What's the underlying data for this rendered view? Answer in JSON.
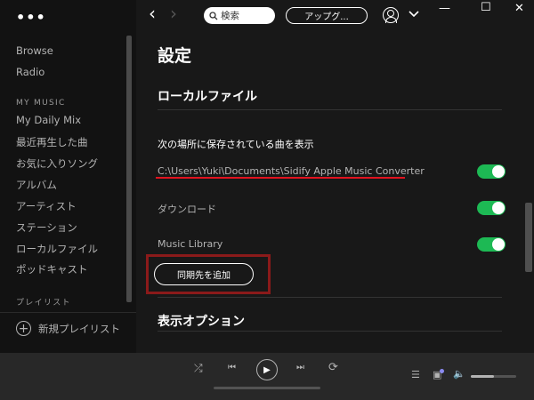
{
  "window": {
    "menu_dots": "•••",
    "minimize": "—",
    "maximize": "☐",
    "close": "✕"
  },
  "sidebar": {
    "items_top": [
      "Browse",
      "Radio"
    ],
    "my_music_heading": "MY MUSIC",
    "my_music": [
      "My Daily Mix",
      "最近再生した曲",
      "お気に入りソング",
      "アルバム",
      "アーティスト",
      "ステーション",
      "ローカルファイル",
      "ポッドキャスト"
    ],
    "playlist_heading": "プレイリスト",
    "new_playlist": "新規プレイリスト"
  },
  "topbar": {
    "back": "‹",
    "forward": "›",
    "search_placeholder": "検索",
    "upgrade_label": "アップグ...",
    "caret": "⌄"
  },
  "settings": {
    "title": "設定",
    "local_files_section": "ローカルファイル",
    "show_songs_from": "次の場所に保存されている曲を表示",
    "sources": [
      {
        "label": "C:\\Users\\Yuki\\Documents\\Sidify Apple Music Converter",
        "enabled": true
      },
      {
        "label": "ダウンロード",
        "enabled": true
      },
      {
        "label": "Music Library",
        "enabled": true
      }
    ],
    "add_source_button": "同期先を追加",
    "display_options_section": "表示オプション"
  },
  "player": {
    "shuffle": "⤮",
    "prev": "⏮",
    "play": "▶",
    "next": "⏭",
    "repeat": "⟳",
    "queue": "☰",
    "devices": "▣",
    "volume": "🔈",
    "volume_level": 0.5,
    "progress": 0
  },
  "colors": {
    "accent_green": "#1db954",
    "highlight_red": "#e1131f",
    "highlight_box": "#8b1a1a"
  }
}
